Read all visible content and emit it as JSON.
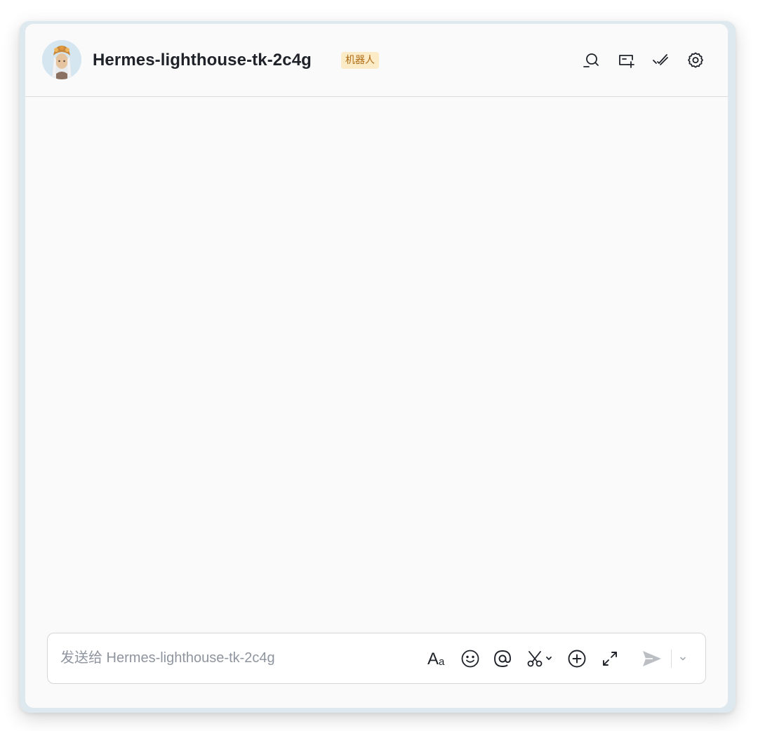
{
  "header": {
    "title": "Hermes-lighthouse-tk-2c4g",
    "badge": "机器人",
    "icons": [
      "search-chat-icon",
      "add-tab-icon",
      "mark-done-icon",
      "settings-icon"
    ]
  },
  "composer": {
    "placeholder": "发送给 Hermes-lighthouse-tk-2c4g",
    "value": "",
    "tools": [
      "text-format-icon",
      "emoji-icon",
      "mention-icon",
      "screenshot-icon",
      "add-icon",
      "expand-icon"
    ],
    "send_icon": "send-icon",
    "send_options_icon": "chevron-down-icon"
  },
  "colors": {
    "background": "#fafafa",
    "title": "#1f2329",
    "badge_bg": "#fbecc7",
    "badge_text": "#b06a13",
    "icon": "#1f2329",
    "placeholder": "#8f959e",
    "send_disabled": "#bbbfc4"
  }
}
